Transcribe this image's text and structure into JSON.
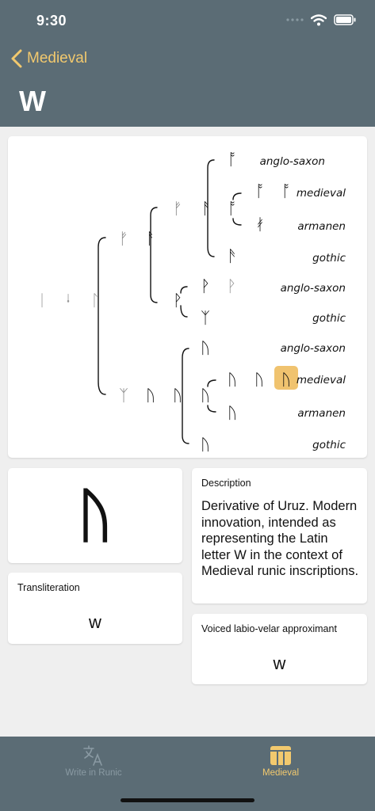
{
  "status_bar": {
    "time": "9:30"
  },
  "nav": {
    "back_label": "Medieval",
    "title": "W"
  },
  "tree": {
    "root_glyphs": [
      "ᛁ",
      "ᛍ",
      "ᛚ"
    ],
    "branch_f": {
      "glyphs": [
        "ᚠ",
        "ᚠ",
        "ᚨ"
      ],
      "ansuz": {
        "glyph": "ᚨ",
        "variants": [
          {
            "glyphs": [
              "ᚩ"
            ],
            "label": "anglo-saxon"
          },
          {
            "glyphs": [
              "ᚩ",
              "ᚩ",
              "ᚩ"
            ],
            "label": "medieval"
          },
          {
            "glyphs": [
              "ᚯ"
            ],
            "label": "armanen"
          },
          {
            "glyphs": [
              "ᚫ"
            ],
            "label": "gothic"
          }
        ]
      },
      "wynn": {
        "glyph": "ᚹ",
        "variants": [
          {
            "glyphs": [
              "ᚹ",
              "ᚹ"
            ],
            "label": "anglo-saxon"
          },
          {
            "glyphs": [
              "ᛉ"
            ],
            "label": "gothic"
          }
        ]
      }
    },
    "branch_u": {
      "glyphs": [
        "ᛉ",
        "ᚢ",
        "ᚢ",
        "ᚢ"
      ],
      "variants": [
        {
          "glyphs": [
            "ᚢ"
          ],
          "label": "anglo-saxon"
        },
        {
          "glyphs": [
            "ᚢ",
            "ᚢ",
            "ᚢ"
          ],
          "label": "medieval"
        },
        {
          "glyphs": [
            "ᚢ"
          ],
          "label": "armanen"
        },
        {
          "glyphs": [
            "ᚢ"
          ],
          "label": "gothic"
        }
      ]
    }
  },
  "rune_card": {
    "glyph": "ᚢ"
  },
  "transliteration": {
    "label": "Transliteration",
    "value": "w"
  },
  "description": {
    "label": "Description",
    "text": "Derivative of Uruz. Modern innovation, intended as representing the Latin letter W in the context of Medieval runic inscriptions."
  },
  "phoneme": {
    "label": "Voiced labio-velar approximant",
    "value": "w"
  },
  "tabs": [
    {
      "label": "Write in Runic",
      "icon": "translate-icon",
      "active": false
    },
    {
      "label": "Medieval",
      "icon": "columns-icon",
      "active": true
    }
  ],
  "colors": {
    "header_bg": "#5b6c75",
    "accent": "#f2c96e",
    "highlight": "#f0c36f",
    "page_bg": "#efefef"
  }
}
